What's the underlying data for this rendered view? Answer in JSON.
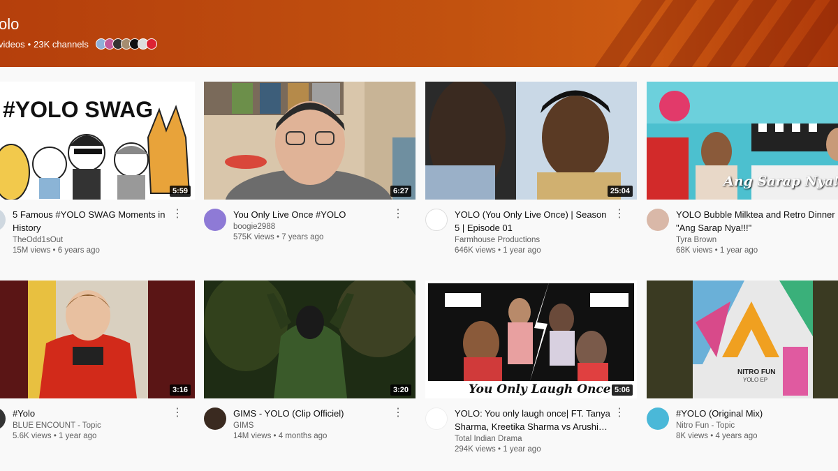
{
  "banner": {
    "title": "olo",
    "videos": "videos",
    "channels": "23K channels"
  },
  "videos": [
    {
      "title": "5 Famous #YOLO SWAG Moments in History",
      "channel": "TheOdd1sOut",
      "views": "15M views",
      "age": "6 years ago",
      "duration": "5:59",
      "thumb_text": "#YOLO SWAG"
    },
    {
      "title": "You Only Live Once #YOLO",
      "channel": "boogie2988",
      "views": "575K views",
      "age": "7 years ago",
      "duration": "6:27"
    },
    {
      "title": "YOLO (You Only Live Once) | Season 5 | Episode 01",
      "channel": "Farmhouse Productions",
      "views": "646K views",
      "age": "1 year ago",
      "duration": "25:04"
    },
    {
      "title": "YOLO Bubble Milktea and Retro Dinner \"Ang Sarap Nya!!!\"",
      "channel": "Tyra Brown",
      "views": "68K views",
      "age": "1 year ago",
      "duration": "",
      "thumb_text": "Ang Sarap Nya!!!"
    },
    {
      "title": "#Yolo",
      "channel": "BLUE ENCOUNT - Topic",
      "views": "5.6K views",
      "age": "1 year ago",
      "duration": "3:16"
    },
    {
      "title": "GIMS - YOLO (Clip Officiel)",
      "channel": "GIMS",
      "views": "14M views",
      "age": "4 months ago",
      "duration": "3:20"
    },
    {
      "title": "YOLO: You only laugh once| FT. Tanya Sharma, Kreetika Sharma vs Arushi…",
      "channel": "Total Indian Drama",
      "views": "294K views",
      "age": "1 year ago",
      "duration": "5:06",
      "thumb_text": "You Only Laugh Once"
    },
    {
      "title": "#YOLO (Original Mix)",
      "channel": "Nitro Fun - Topic",
      "views": "8K views",
      "age": "4 years ago",
      "duration": "",
      "thumb_text": "NITRO FUN",
      "thumb_sub": "YOLO EP"
    }
  ],
  "separator": "•",
  "more_icon": "⋮"
}
